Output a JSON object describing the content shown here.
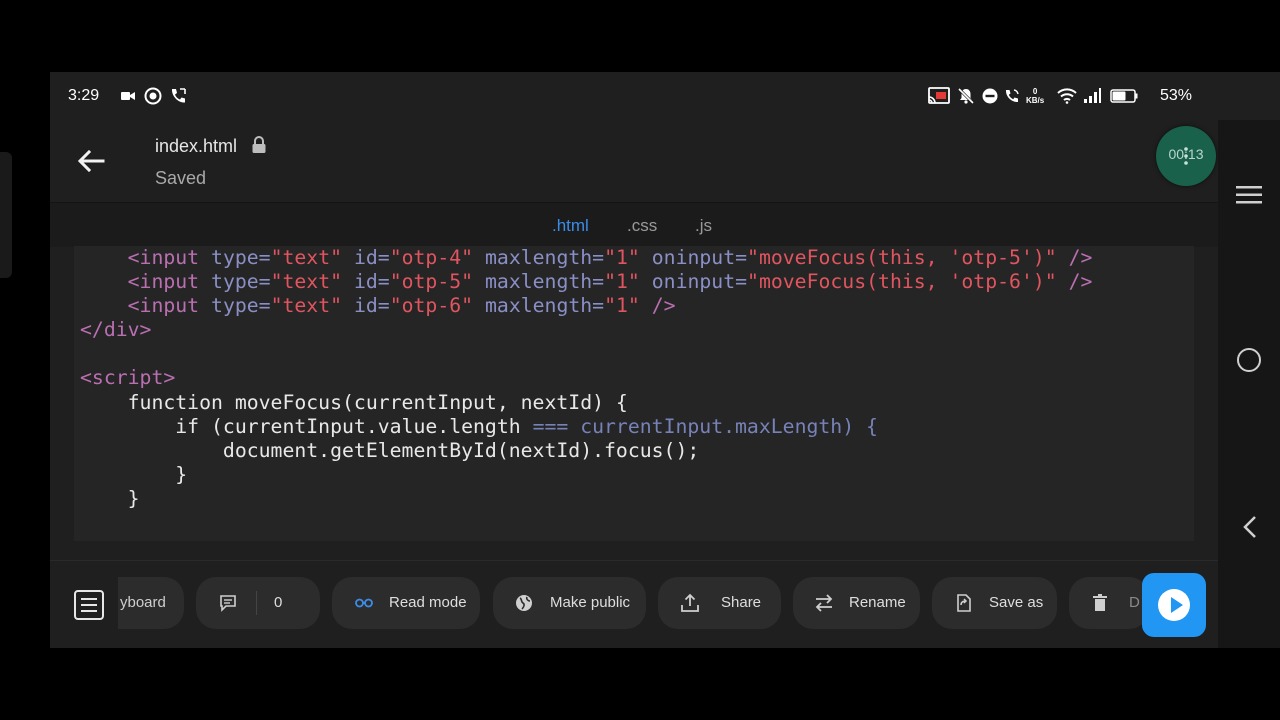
{
  "status_bar": {
    "time": "3:29",
    "net_speed_value": "0",
    "net_speed_unit": "KB/s",
    "battery_percent": "53%",
    "icons": [
      "video-camera-icon",
      "whatsapp-icon",
      "call-icon",
      "cast-icon",
      "bell-muted-icon",
      "do-not-disturb-icon",
      "wifi-call-icon",
      "wifi-icon",
      "signal-icon",
      "battery-icon"
    ]
  },
  "header": {
    "file_name": "index.html",
    "status": "Saved",
    "timer": "00:13"
  },
  "tabs": [
    {
      "label": ".html",
      "active": true
    },
    {
      "label": ".css",
      "active": false
    },
    {
      "label": ".js",
      "active": false
    }
  ],
  "code": {
    "language": "html",
    "lines": [
      "    <input type=\"text\" id=\"otp-4\" maxlength=\"1\" oninput=\"moveFocus(this, 'otp-5')\" />",
      "    <input type=\"text\" id=\"otp-5\" maxlength=\"1\" oninput=\"moveFocus(this, 'otp-6')\" />",
      "    <input type=\"text\" id=\"otp-6\" maxlength=\"1\" />",
      "</div>",
      "",
      "<script>",
      "    function moveFocus(currentInput, nextId) {",
      "        if (currentInput.value.length === currentInput.maxLength) {",
      "            document.getElementById(nextId).focus();",
      "        }",
      "    }"
    ]
  },
  "bottom_bar": {
    "actions": [
      {
        "label": "yboard",
        "icon": "keyboard-icon"
      },
      {
        "label": "0",
        "icon": "comment-icon"
      },
      {
        "label": "Read mode",
        "icon": "glasses-icon"
      },
      {
        "label": "Make public",
        "icon": "globe-icon"
      },
      {
        "label": "Share",
        "icon": "share-icon"
      },
      {
        "label": "Rename",
        "icon": "swap-icon"
      },
      {
        "label": "Save as",
        "icon": "save-as-icon"
      },
      {
        "label": "D",
        "icon": "trash-icon"
      }
    ],
    "run_icon": "play-icon"
  },
  "colors": {
    "accent": "#3c8ce7",
    "run_button": "#2196f3",
    "timer_bg": "#19614b",
    "code_tag": "#b96fb1",
    "code_attr": "#8a8fc6",
    "code_string": "#e0555f"
  }
}
